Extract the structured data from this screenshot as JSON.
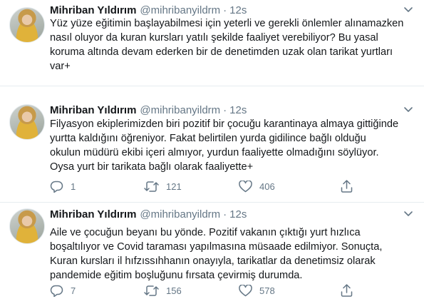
{
  "tweets": [
    {
      "name": "Mihriban Yıldırım",
      "handle": "@mihribanyildrm",
      "separator": "·",
      "time": "12s",
      "lines": [
        "Yüz yüze eğitimin başlayabilmesi için yeterli ve gerekli önlemler alınamazken",
        "nasıl oluyor da kuran kursları yatılı şekilde faaliyet verebiliyor? Bu yasal",
        "koruma altında devam ederken bir de denetimden uzak olan tarikat yurtları",
        "var+"
      ]
    },
    {
      "name": "Mihriban Yıldırım",
      "handle": "@mihribanyildrm",
      "separator": "·",
      "time": "12s",
      "lines": [
        "Filyasyon ekiplerimizden biri pozitif bir çocuğu karantinaya almaya gittiğinde",
        "yurtta kaldığını öğreniyor. Fakat belirtilen yurda gidilince bağlı olduğu",
        "okulun müdürü ekibi içeri almıyor, yurdun faaliyette olmadığını söylüyor.",
        "Oysa yurt bir tarikata bağlı olarak faaliyette+"
      ],
      "actions": {
        "replies": "1",
        "retweets": "121",
        "likes": "406"
      }
    },
    {
      "name": "Mihriban Yıldırım",
      "handle": "@mihribanyildrm",
      "separator": "·",
      "time": "12s",
      "lines": [
        "Aile ve çocuğun beyanı bu yönde. Pozitif vakanın çıktığı yurt hızlıca",
        "boşaltılıyor ve Covid taraması yapılmasına müsaade edilmiyor. Sonuçta,",
        "Kuran kursları il hıfzıssıhhanın onayıyla, tarikatlar da denetimsiz olarak",
        "pandemide eğitim boşluğunu fırsata çevirmiş durumda."
      ],
      "actions": {
        "replies": "7",
        "retweets": "156",
        "likes": "578"
      }
    }
  ],
  "icons": {
    "reply": "reply-icon",
    "retweet": "retweet-icon",
    "like": "heart-icon",
    "share": "share-icon",
    "more": "chevron-down-icon"
  },
  "colors": {
    "text": "#14171a",
    "secondary": "#657786",
    "divider": "#e6ecf0"
  }
}
